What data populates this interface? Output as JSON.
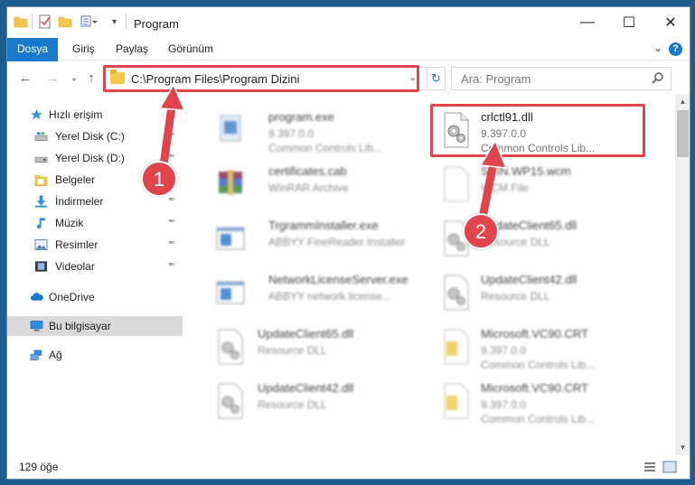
{
  "window": {
    "title": "Program",
    "minimize_glyph": "—",
    "maximize_glyph": "☐",
    "close_glyph": "✕"
  },
  "ribbon": {
    "tabs": [
      "Dosya",
      "Giriş",
      "Paylaş",
      "Görünüm"
    ],
    "help_label": "?",
    "collapse_glyph": "⌄"
  },
  "nav": {
    "back_glyph": "←",
    "forward_glyph": "→",
    "recent_glyph": "⌄",
    "up_glyph": "↑"
  },
  "address": {
    "path": "C:\\Program Files\\Program Dizini",
    "dropdown_glyph": "⌄",
    "refresh_glyph": "↻"
  },
  "search": {
    "placeholder": "Ara: Program"
  },
  "sidebar": {
    "items": [
      {
        "label": "Hızlı erişim",
        "icon": "star-icon",
        "pinned": false
      },
      {
        "label": "Yerel Disk (C:)",
        "icon": "drive-icon",
        "pinned": true
      },
      {
        "label": "Yerel Disk (D:)",
        "icon": "drive-icon",
        "pinned": true
      },
      {
        "label": "Belgeler",
        "icon": "documents-icon",
        "pinned": true
      },
      {
        "label": "İndirmeler",
        "icon": "download-icon",
        "pinned": true
      },
      {
        "label": "Müzik",
        "icon": "music-icon",
        "pinned": true
      },
      {
        "label": "Resimler",
        "icon": "pictures-icon",
        "pinned": true
      },
      {
        "label": "Videolar",
        "icon": "videos-icon",
        "pinned": true
      },
      {
        "label": "OneDrive",
        "icon": "cloud-icon",
        "pinned": false
      },
      {
        "label": "Bu bilgisayar",
        "icon": "computer-icon",
        "pinned": false,
        "selected": true
      },
      {
        "label": "Ağ",
        "icon": "network-icon",
        "pinned": false
      }
    ],
    "pin_glyph": "📌"
  },
  "files": [
    {
      "name": "program.exe",
      "line1": "9.397.0.0",
      "line2": "Common Controls Lib...",
      "icon": "exe-icon",
      "blurred": true
    },
    {
      "name": "crlctl91.dll",
      "line1": "9.397.0.0",
      "line2": "Common Controls Lib...",
      "icon": "dll-gear-icon",
      "blurred": false
    },
    {
      "name": "certificates.cab",
      "line1": "WinRAR Archive",
      "line2": "",
      "icon": "archive-icon",
      "blurred": true
    },
    {
      "name": "SKIN.WP15.wcm",
      "line1": "WCM File",
      "line2": "",
      "icon": "blank-file-icon",
      "blurred": true
    },
    {
      "name": "TrgrammInstaller.exe",
      "line1": "ABBYY FineReader Installer",
      "line2": "",
      "icon": "window-app-icon",
      "blurred": true
    },
    {
      "name": "UpdateClient65.dll",
      "line1": "Resource DLL",
      "line2": "",
      "icon": "dll-gear-icon",
      "blurred": true
    },
    {
      "name": "NetworkLicenseServer.exe",
      "line1": "ABBYY network license...",
      "line2": "",
      "icon": "window-app-icon",
      "blurred": true
    },
    {
      "name": "UpdateClient42.dll",
      "line1": "Resource DLL",
      "line2": "",
      "icon": "dll-gear-icon",
      "blurred": true
    },
    {
      "name": "UpdateClient65.dll",
      "line1": "Resource DLL",
      "line2": "",
      "icon": "dll-gear-icon",
      "blurred": true
    },
    {
      "name": "Microsoft.VC90.CRT",
      "line1": "9.397.0.0",
      "line2": "Common Controls Lib...",
      "icon": "folder-file-icon",
      "blurred": true
    },
    {
      "name": "UpdateClient42.dll",
      "line1": "Resource DLL",
      "line2": "",
      "icon": "dll-gear-icon",
      "blurred": true
    },
    {
      "name": "Microsoft.VC90.CRT",
      "line1": "9.397.0.0",
      "line2": "Common Controls Lib...",
      "icon": "folder-file-icon",
      "blurred": true
    }
  ],
  "status": {
    "count": "129 öğe"
  },
  "annotations": {
    "step1": "1",
    "step2": "2"
  },
  "colors": {
    "accent": "#1979ca",
    "highlight_red": "#e0454e",
    "selected_nav": "#d9d9d9"
  }
}
